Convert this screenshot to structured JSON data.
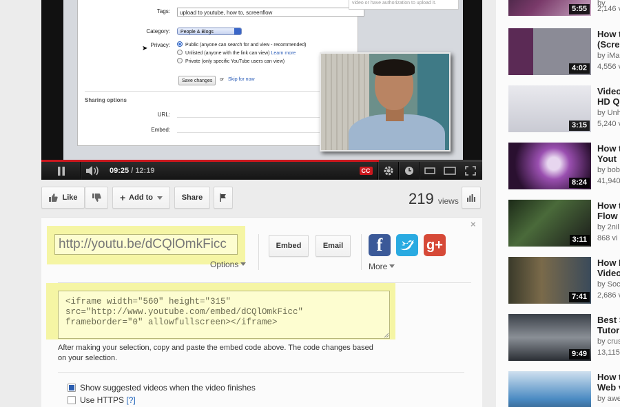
{
  "player": {
    "form": {
      "tags_label": "Tags:",
      "tags_value": "upload to youtube, how to, screenflow",
      "category_label": "Category:",
      "category_value": "People & Blogs",
      "privacy_label": "Privacy:",
      "privacy_public": "Public (anyone can search for and view - recommended)",
      "privacy_unlisted": "Unlisted (anyone with the link can view)",
      "learn_more": "Learn more",
      "privacy_private": "Private (only specific YouTube users can view)",
      "save_changes": "Save changes",
      "or": "or",
      "skip_for_now": "Skip for now",
      "sharing_options": "Sharing options",
      "url_label": "URL:",
      "embed_label": "Embed:",
      "side_note": "video or have authorization to upload it."
    },
    "current_time": "09:25",
    "separator": " / ",
    "duration": "12:19",
    "progress_fraction": 0.765,
    "cc_label": "CC"
  },
  "actions": {
    "like": "Like",
    "add_to": "Add to",
    "share": "Share",
    "views_count": "219",
    "views_label": "views"
  },
  "share": {
    "short_url": "http://youtu.be/dCQlOmkFicc",
    "options": "Options",
    "embed_button": "Embed",
    "email_button": "Email",
    "facebook": "f",
    "google_plus": "g+",
    "more": "More",
    "embed_code": "<iframe width=\"560\" height=\"315\"\nsrc=\"http://www.youtube.com/embed/dCQlOmkFicc\"\nframeborder=\"0\" allowfullscreen></iframe>",
    "embed_help": "After making your selection, copy and paste the embed code above. The code changes based on your selection.",
    "show_suggested": "Show suggested videos when the video finishes",
    "use_https": "Use HTTPS",
    "help_link": "[?]"
  },
  "related": [
    {
      "title": "",
      "title2": "",
      "by": "by",
      "views": "2,146 v",
      "duration": "5:55"
    },
    {
      "title": "How t",
      "title2": "(Scre",
      "by": "by iMa",
      "views": "4,556 v",
      "duration": "4:02"
    },
    {
      "title": "Video",
      "title2": "HD Q",
      "by": "by Unh",
      "views": "5,240 v",
      "duration": "3:15"
    },
    {
      "title": "How t",
      "title2": "Yout",
      "by": "by bob",
      "views": "41,940",
      "duration": "8:24"
    },
    {
      "title": "How t",
      "title2": "Flow",
      "by": "by 2nil",
      "views": "868 vi",
      "duration": "3:11"
    },
    {
      "title": "How I",
      "title2": "Video",
      "by": "by Soc",
      "views": "2,686 v",
      "duration": "7:41"
    },
    {
      "title": "Best S",
      "title2": "Tutor",
      "by": "by crus",
      "views": "13,115",
      "duration": "9:49"
    },
    {
      "title": "How t",
      "title2": "Web v",
      "by": "by awe",
      "views": "",
      "duration": ""
    }
  ],
  "colors": {
    "progress_red": "#cc181e",
    "highlight_yellow": "#f5f5a4",
    "facebook_blue": "#3b5998",
    "twitter_blue": "#29aae1",
    "google_red": "#d64937"
  }
}
